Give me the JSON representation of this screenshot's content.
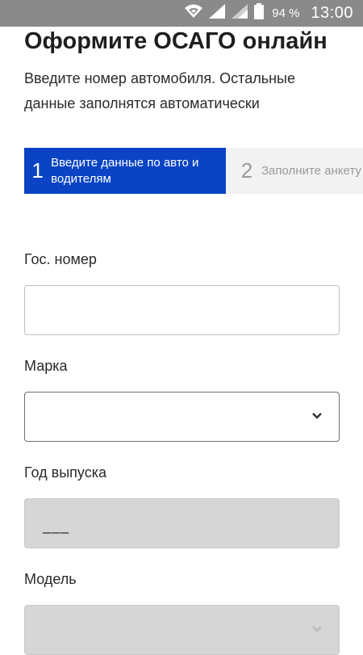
{
  "statusbar": {
    "battery": "94 %",
    "time": "13:00"
  },
  "header": {
    "title": "Оформите ОСАГО онлайн",
    "subtitle": "Введите номер автомобиля. Остальные данные заполнятся автоматически"
  },
  "stepper": {
    "steps": [
      {
        "number": "1",
        "label": "Введите данные по авто и водителям"
      },
      {
        "number": "2",
        "label": "Заполните анкету"
      }
    ]
  },
  "form": {
    "plate": {
      "label": "Гос. номер",
      "value": ""
    },
    "brand": {
      "label": "Марка",
      "value": ""
    },
    "year": {
      "label": "Год выпуска",
      "value": "___"
    },
    "model": {
      "label": "Модель",
      "value": ""
    }
  },
  "colors": {
    "accent": "#0a44c4",
    "statusbar": "#8a8a8a",
    "disabled": "#d6d6d6"
  }
}
